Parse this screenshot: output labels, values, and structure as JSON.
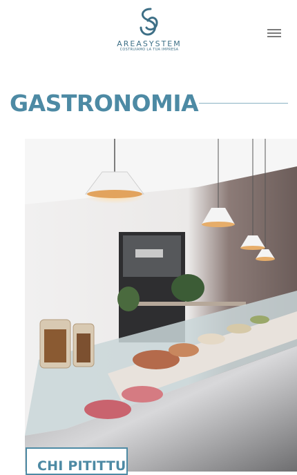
{
  "header": {
    "brand_name": "AREASYSTEM",
    "brand_tagline": "COSTRUIAMO LA TUA IMPRESA",
    "menu_icon": "hamburger-menu-icon"
  },
  "main": {
    "page_title": "GASTRONOMIA",
    "project_card": {
      "label": "CHI PITITTU",
      "image_subject": "deli-counter-photo"
    }
  },
  "colors": {
    "accent": "#4d8aa4",
    "rule": "#8ab2c2",
    "logo": "#3d6f86"
  }
}
